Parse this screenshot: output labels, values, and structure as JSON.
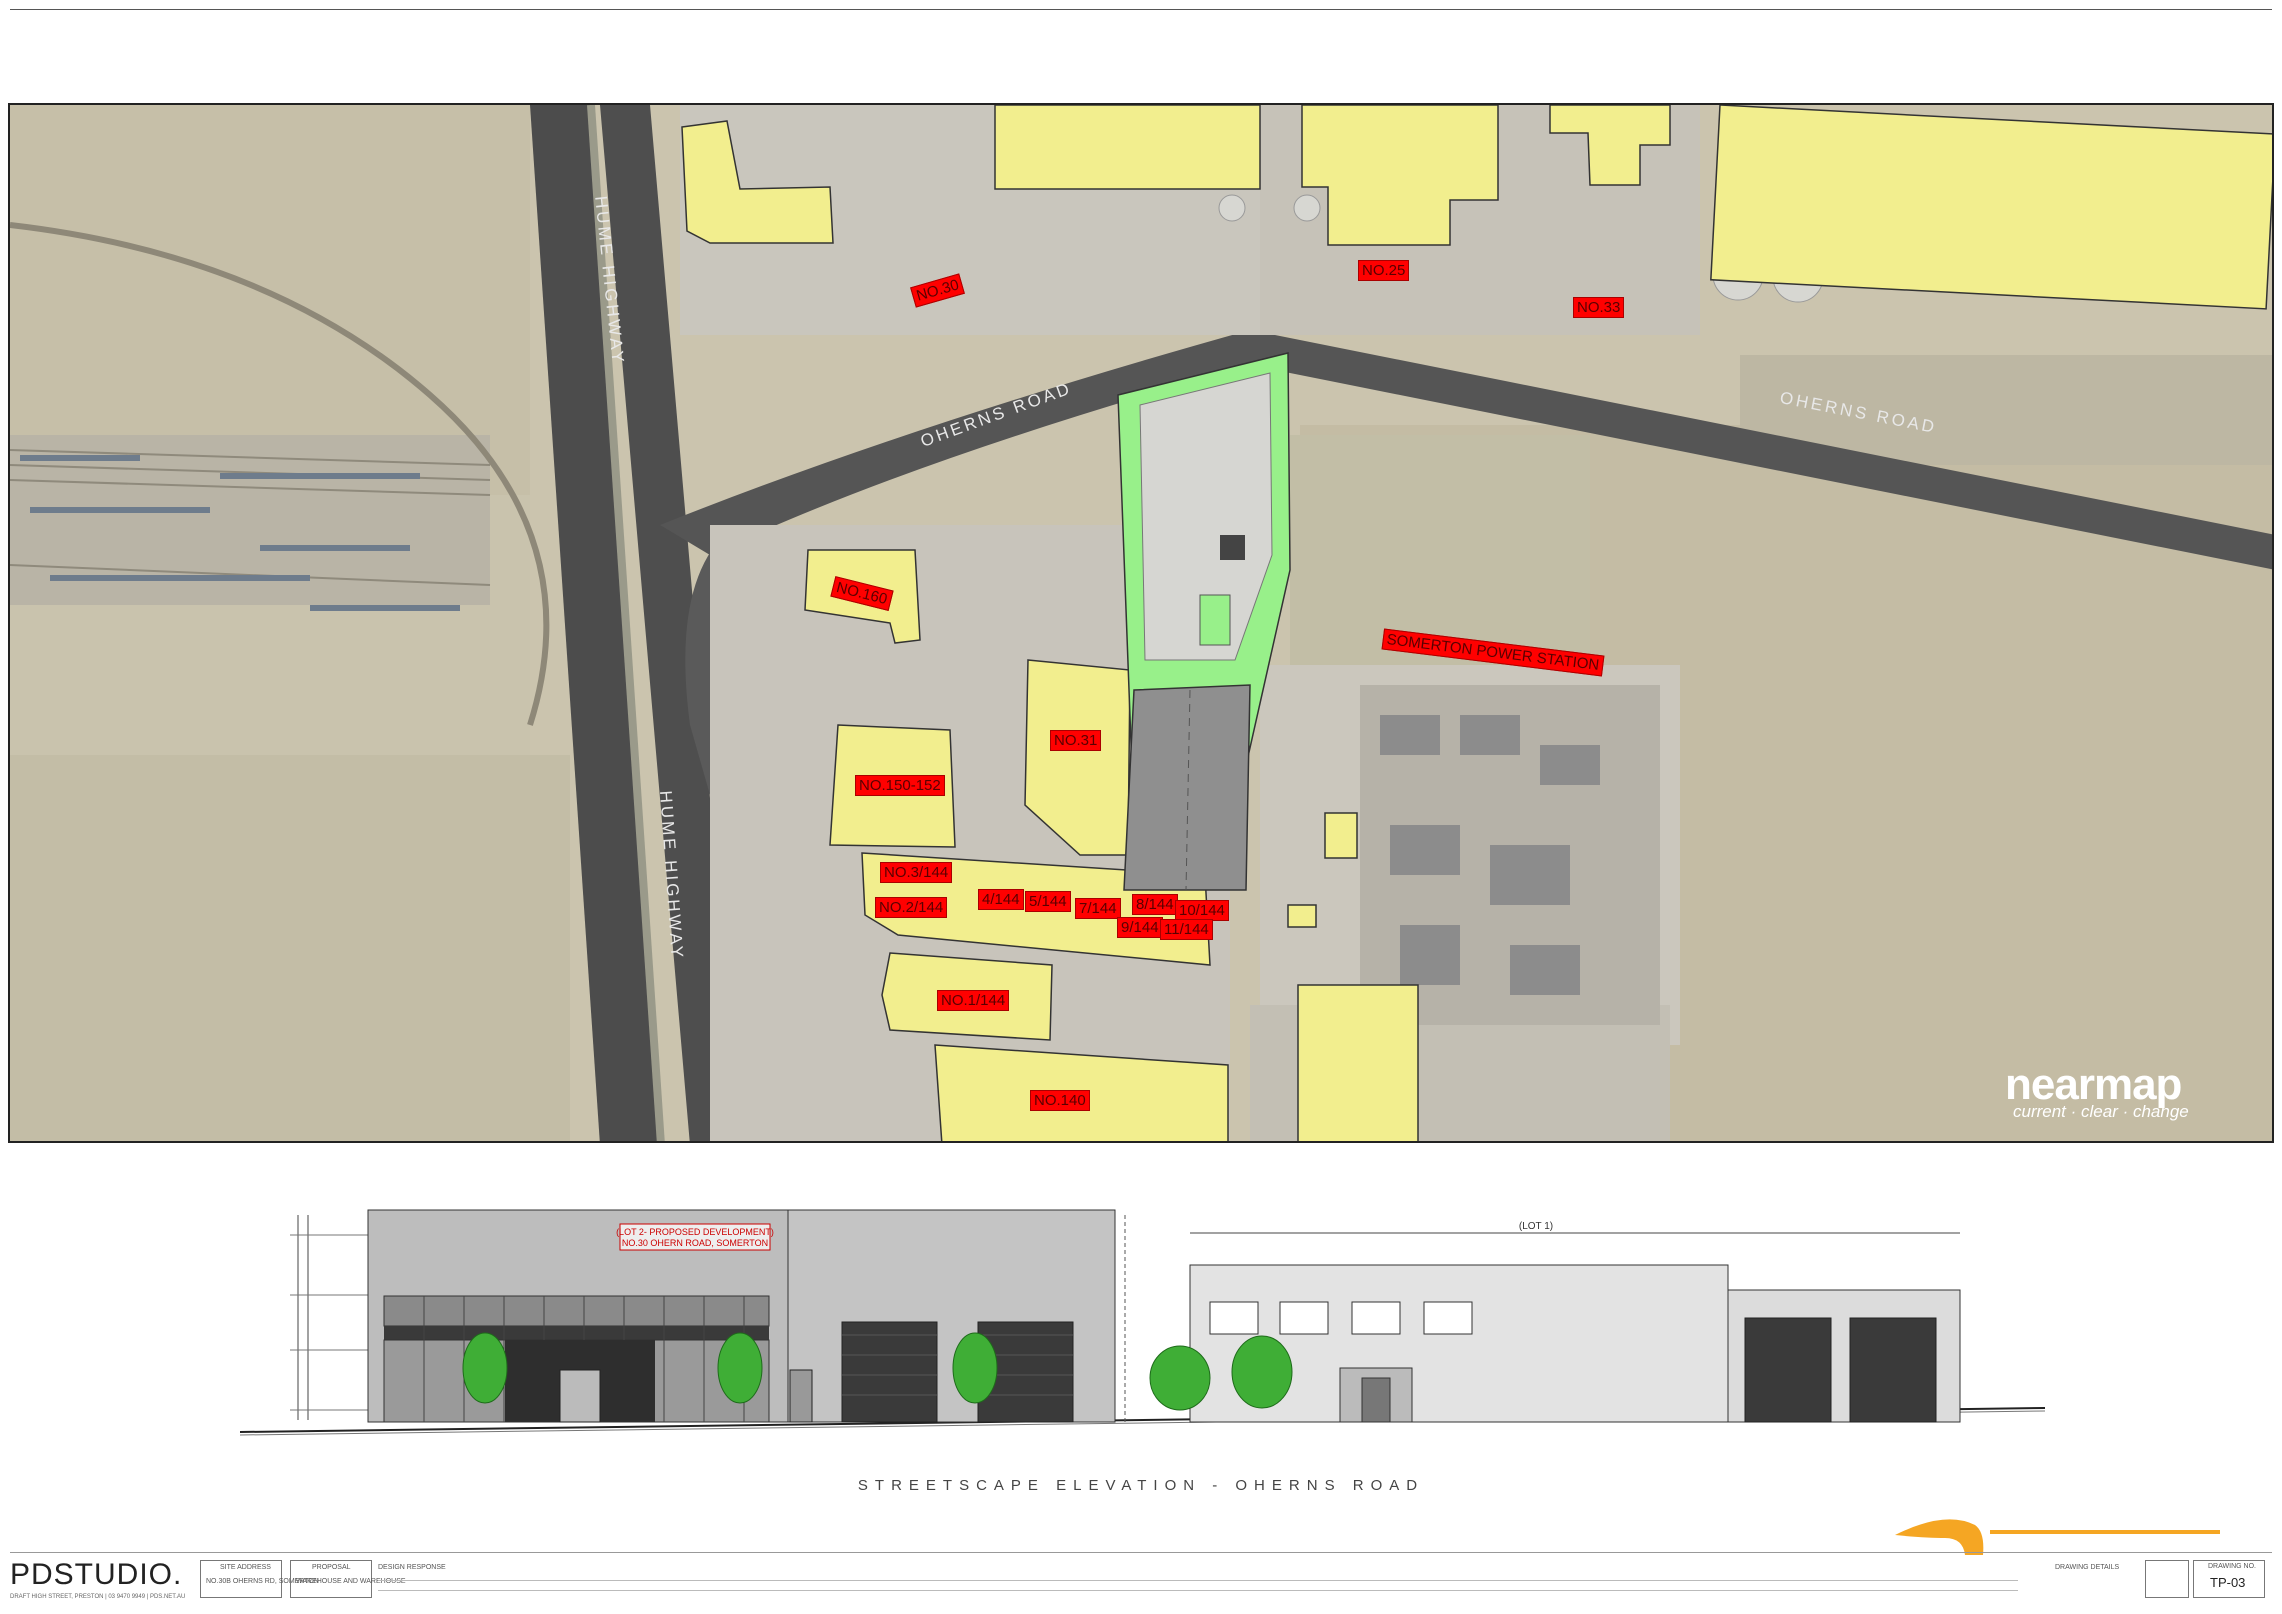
{
  "map": {
    "roads": {
      "hume_1": "HUME HIGHWAY",
      "hume_2": "HUME HIGHWAY",
      "oherns_1": "OHERNS ROAD",
      "oherns_2": "OHERNS ROAD"
    },
    "labels": [
      {
        "id": "no30a",
        "text": "NO.30"
      },
      {
        "id": "no25",
        "text": "NO.25"
      },
      {
        "id": "no33",
        "text": "NO.33"
      },
      {
        "id": "no160",
        "text": "NO.160"
      },
      {
        "id": "no31",
        "text": "NO.31"
      },
      {
        "id": "no150",
        "text": "NO.150-152"
      },
      {
        "id": "somerton",
        "text": "SOMERTON POWER STATION"
      },
      {
        "id": "no3144",
        "text": "NO.3/144"
      },
      {
        "id": "no2144",
        "text": "NO.2/144"
      },
      {
        "id": "u4144",
        "text": "4/144"
      },
      {
        "id": "u5144",
        "text": "5/144"
      },
      {
        "id": "u7144",
        "text": "7/144"
      },
      {
        "id": "u8144",
        "text": "8/144"
      },
      {
        "id": "u9144",
        "text": "9/144"
      },
      {
        "id": "u10144",
        "text": "10/144"
      },
      {
        "id": "u11144",
        "text": "11/144"
      },
      {
        "id": "no1144",
        "text": "NO.1/144"
      },
      {
        "id": "no140",
        "text": "NO.140"
      }
    ],
    "logo": {
      "name": "nearmap",
      "tagline": "current · clear · change"
    },
    "colors": {
      "aerial": "#cfc8b4",
      "building": "#f2ee8e",
      "site": "#98f08a",
      "label": "#ff0000",
      "road": "#505050"
    }
  },
  "elevation": {
    "title": "STREETSCAPE ELEVATION - OHERNS ROAD",
    "lot2_line1": "(LOT 2- PROPOSED DEVELOPMENT)",
    "lot2_line2": "NO.30 OHERN ROAD, SOMERTON",
    "lot1": "(LOT 1)"
  },
  "titleblock": {
    "company": "PDSTUDIO.",
    "company_info": "DRAFT HIGH STREET, PRESTON | 03 9470 9949 | PDS.NET.AU",
    "site_address_label": "SITE ADDRESS",
    "site_address_value": "NO.30B OHERNS RD, SOMERTON",
    "proposal_label": "PROPOSAL",
    "proposal_value": "WAREHOUSE AND WAREHOUSE",
    "design_label": "DESIGN RESPONSE",
    "drawing_details_label": "DRAWING DETAILS",
    "drawing_no_label": "DRAWING NO.",
    "drawing_no": "TP-03"
  }
}
